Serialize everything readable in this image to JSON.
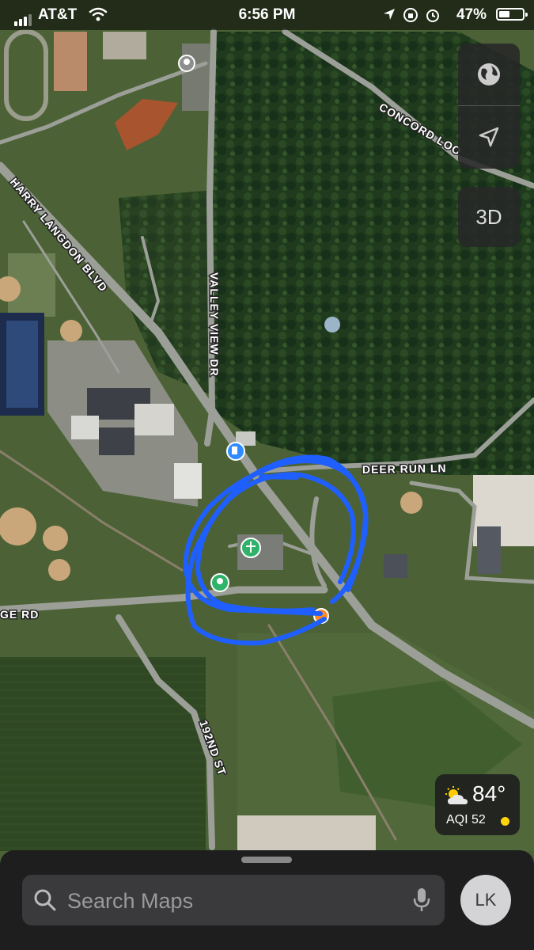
{
  "status_bar": {
    "carrier": "AT&T",
    "time": "6:56 PM",
    "battery_percent": "47%",
    "battery_level": 0.47,
    "icons": [
      "signal-icon",
      "wifi-icon",
      "location-arrow-icon",
      "orientation-lock-icon",
      "alarm-icon",
      "battery-icon"
    ]
  },
  "map": {
    "style": "satellite",
    "road_labels": {
      "harry_langdon": "HARRY LANGDON BLVD",
      "valley_view": "VALLEY VIEW DR",
      "concord_loop": "CONCORD LOO",
      "deer_run": "DEER RUN LN",
      "road_192": "192ND ST",
      "ge_rd": "GE RD"
    },
    "poi_icons": [
      "theater-icon",
      "gas-station-icon",
      "picnic-area-icon",
      "park-icon",
      "food-icon"
    ],
    "annotation_color": "#1f5fff"
  },
  "controls": {
    "globe_icon": "globe-icon",
    "location_icon": "location-arrow-icon",
    "three_d_label": "3D"
  },
  "weather": {
    "icon": "partly-sunny-icon",
    "temperature": "84°",
    "aqi": "AQI 52",
    "aqi_color": "#ffd60a"
  },
  "search": {
    "placeholder": "Search Maps",
    "avatar_initials": "LK"
  }
}
